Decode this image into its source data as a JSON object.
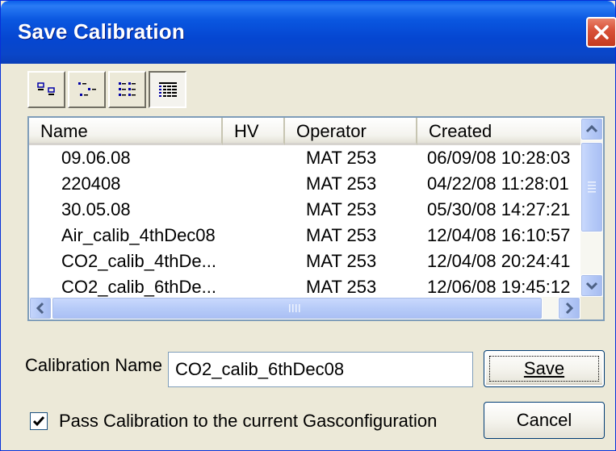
{
  "window": {
    "title": "Save Calibration"
  },
  "view_toolbar": {
    "buttons": [
      {
        "icon": "large-icons-view-icon",
        "active": false
      },
      {
        "icon": "small-icons-view-icon",
        "active": false
      },
      {
        "icon": "list-view-icon",
        "active": false
      },
      {
        "icon": "details-view-icon",
        "active": true
      }
    ]
  },
  "list": {
    "columns": [
      "Name",
      "HV",
      "Operator",
      "Created"
    ],
    "rows": [
      {
        "name": "09.06.08",
        "hv": "",
        "operator": "MAT 253",
        "created": "06/09/08 10:28:03"
      },
      {
        "name": "220408",
        "hv": "",
        "operator": "MAT 253",
        "created": "04/22/08 11:28:01"
      },
      {
        "name": "30.05.08",
        "hv": "",
        "operator": "MAT 253",
        "created": "05/30/08 14:27:21"
      },
      {
        "name": "Air_calib_4thDec08",
        "hv": "",
        "operator": "MAT 253",
        "created": "12/04/08 16:10:57"
      },
      {
        "name": "CO2_calib_4thDe...",
        "hv": "",
        "operator": "MAT 253",
        "created": "12/04/08 20:24:41"
      },
      {
        "name": "CO2_calib_6thDe...",
        "hv": "",
        "operator": "MAT 253",
        "created": "12/06/08 19:45:12"
      }
    ]
  },
  "form": {
    "calibration_name_label": "Calibration Name",
    "calibration_name_value": "CO2_calib_6thDec08",
    "save_label": "Save",
    "cancel_label": "Cancel",
    "pass_calibration_label": "Pass Calibration to the current Gasconfiguration",
    "pass_calibration_checked": true
  },
  "colors": {
    "title_bar": "#0546d1",
    "close_button": "#d9533a",
    "dialog_bg": "#ece9d8",
    "scrollbar_thumb": "#b7cbf8"
  }
}
